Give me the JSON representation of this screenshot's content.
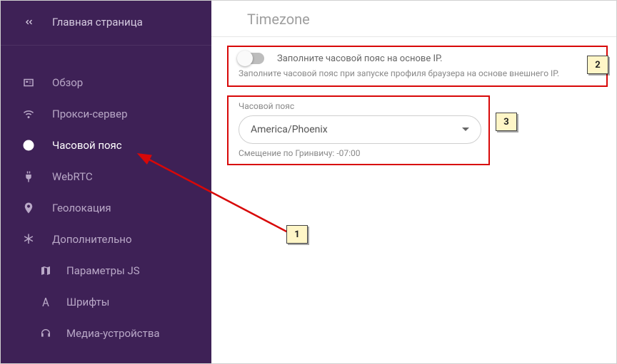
{
  "sidebar": {
    "home": "Главная страница",
    "items": [
      {
        "label": "Обзор"
      },
      {
        "label": "Прокси-сервер"
      },
      {
        "label": "Часовой пояс"
      },
      {
        "label": "WebRTC"
      },
      {
        "label": "Геолокация"
      },
      {
        "label": "Дополнительно"
      }
    ],
    "subitems": [
      {
        "label": "Параметры JS"
      },
      {
        "label": "Шрифты"
      },
      {
        "label": "Медиа-устройства"
      }
    ]
  },
  "header": {
    "title": "Timezone"
  },
  "timezone_panel": {
    "toggle_label": "Заполните часовой пояс на основе IP.",
    "toggle_desc": "Заполните часовой пояс при запуске профиля браузера на основе внешнего IP."
  },
  "tz_select": {
    "label": "Часовой пояс",
    "value": "America/Phoenix",
    "offset_label": "Смещение по Гринвичу:",
    "offset_value": "-07:00"
  },
  "callouts": {
    "c1": "1",
    "c2": "2",
    "c3": "3"
  }
}
